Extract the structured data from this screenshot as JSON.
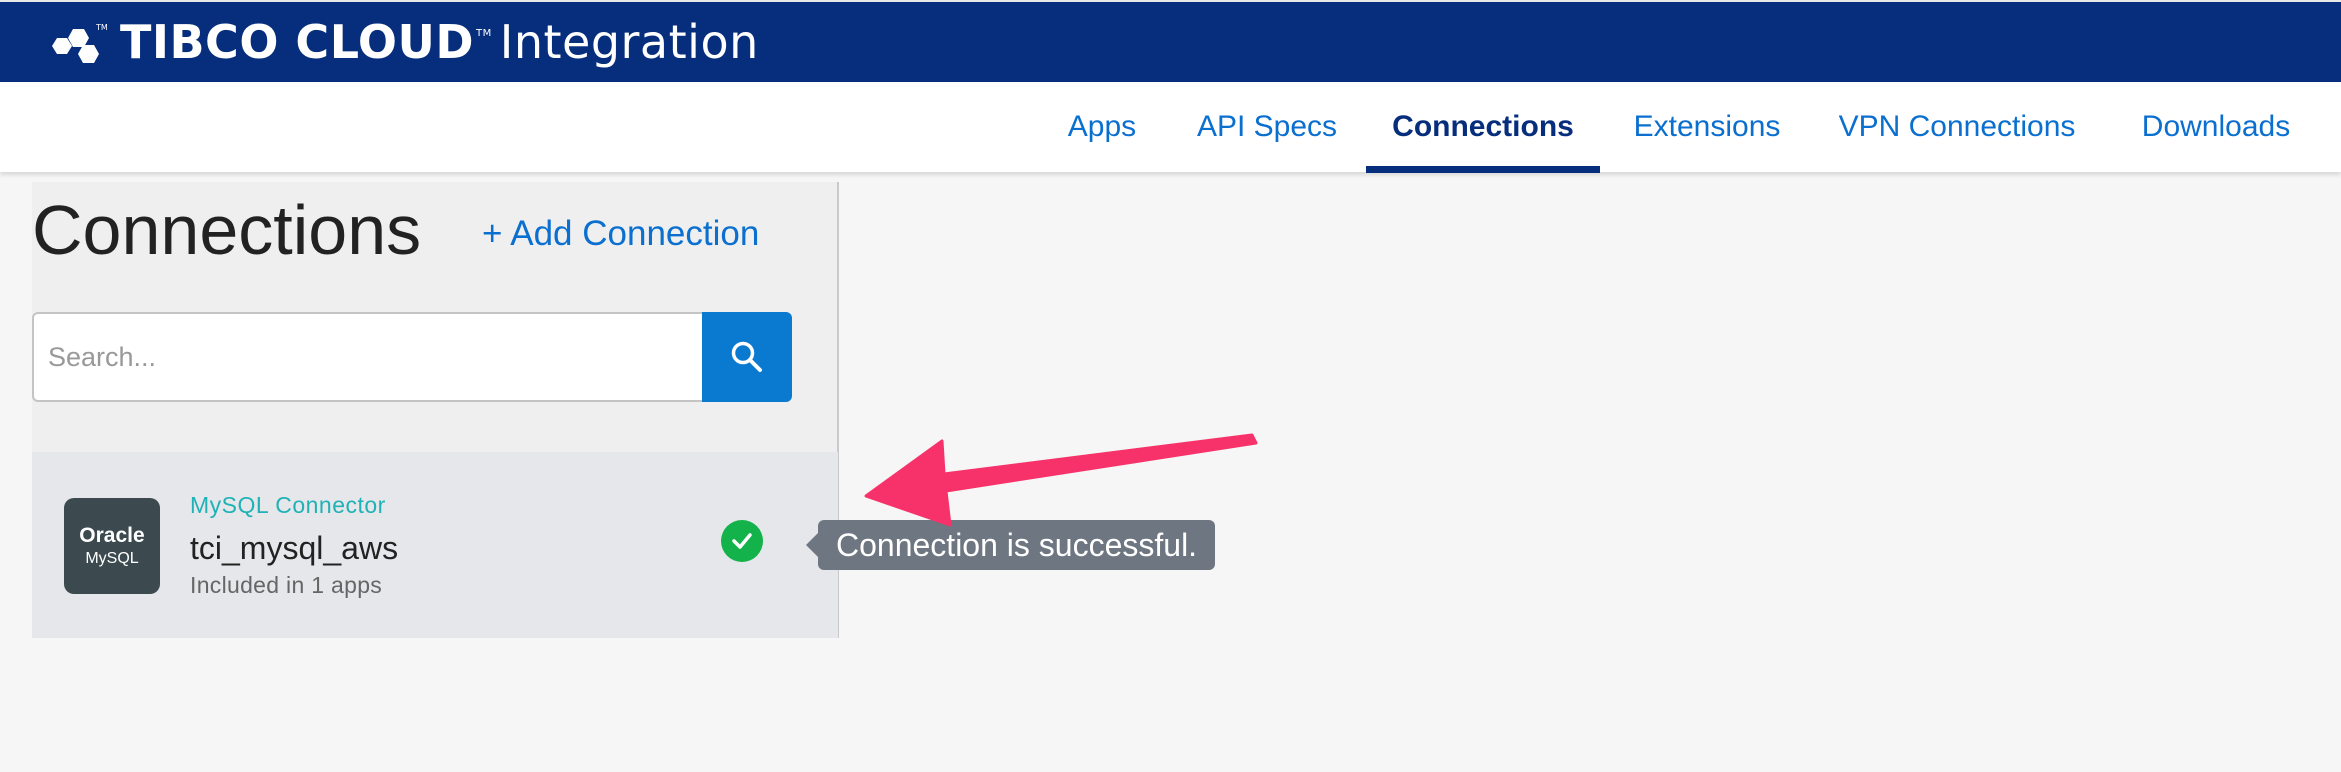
{
  "header": {
    "brand": "TIBCO CLOUD",
    "product": "Integration",
    "brand_color": "#062e7c"
  },
  "nav": {
    "items": [
      {
        "label": "Apps"
      },
      {
        "label": "API Specs"
      },
      {
        "label": "Connections",
        "active": true
      },
      {
        "label": "Extensions"
      },
      {
        "label": "VPN Connections"
      },
      {
        "label": "Downloads"
      }
    ]
  },
  "page": {
    "title": "Connections",
    "add_label": "+ Add Connection"
  },
  "search": {
    "placeholder": "Search...",
    "button_icon": "search-icon"
  },
  "connections": [
    {
      "logo_line1": "Oracle",
      "logo_line2": "MySQL",
      "type": "MySQL Connector",
      "name": "tci_mysql_aws",
      "usage": "Included in 1 apps",
      "status_icon": "check-circle-icon",
      "status_color": "#13b24a"
    }
  ],
  "tooltip": {
    "text": "Connection is successful."
  },
  "annotation": {
    "color": "#f7326a"
  }
}
